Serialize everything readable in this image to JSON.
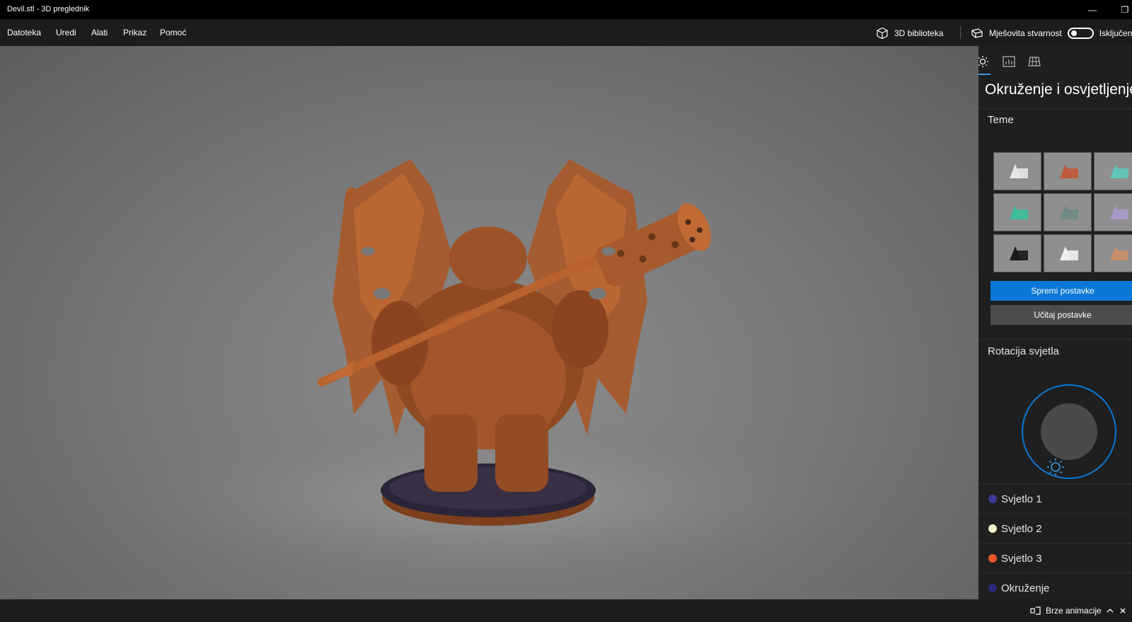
{
  "window": {
    "title": "Devil.stl - 3D preglednik",
    "minimize_glyph": "—",
    "restore_glyph": "❐"
  },
  "menu": {
    "items": [
      "Datoteka",
      "Uredi",
      "Alati",
      "Prikaz",
      "Pomoć"
    ]
  },
  "toolbar": {
    "library_label": "3D biblioteka",
    "library_icon": "cube-icon",
    "mixed_reality_label": "Mješovita stvarnost",
    "mixed_reality_icon": "mixed-reality-icon",
    "mixed_reality_state": "Isključeno",
    "mixed_reality_on": false
  },
  "viewport": {
    "model": "Devil.stl",
    "model_color": "#b5622e"
  },
  "panel": {
    "tabs": [
      {
        "name": "environment-lighting",
        "icon": "sun-icon",
        "active": true
      },
      {
        "name": "statistics",
        "icon": "stats-icon",
        "active": false
      },
      {
        "name": "grid",
        "icon": "grid-icon",
        "active": false
      }
    ],
    "title": "Okruženje i osvjetljenje",
    "themes_label": "Teme",
    "themes": [
      {
        "bg": "#8f8f8f",
        "shape": "#e8e8e8"
      },
      {
        "bg": "#8f8f8f",
        "shape": "#c0583a"
      },
      {
        "bg": "#8f8f8f",
        "shape": "#5fc8b8"
      },
      {
        "bg": "#8f8f8f",
        "shape": "#3fbf9c"
      },
      {
        "bg": "#8f8f8f",
        "shape": "#6f8a84"
      },
      {
        "bg": "#8f8f8f",
        "shape": "#a89ac8"
      },
      {
        "bg": "#8f8f8f",
        "shape": "#1a1a1a"
      },
      {
        "bg": "#8f8f8f",
        "shape": "#f0f0f0"
      },
      {
        "bg": "#8f8f8f",
        "shape": "#c8906a"
      }
    ],
    "save_button": "Spremi postavke",
    "load_button": "Učitaj postavke",
    "rotation_label": "Rotacija svjetla",
    "accent_color": "#0a78d7",
    "lights": [
      {
        "label": "Svjetlo 1",
        "color": "#3a3a9a"
      },
      {
        "label": "Svjetlo 2",
        "color": "#f3f0c8"
      },
      {
        "label": "Svjetlo 3",
        "color": "#e8562a"
      },
      {
        "label": "Okruženje",
        "color": "#2a2a7a"
      }
    ]
  },
  "status": {
    "animations_label": "Brze animacije",
    "animations_icon": "animation-icon"
  }
}
